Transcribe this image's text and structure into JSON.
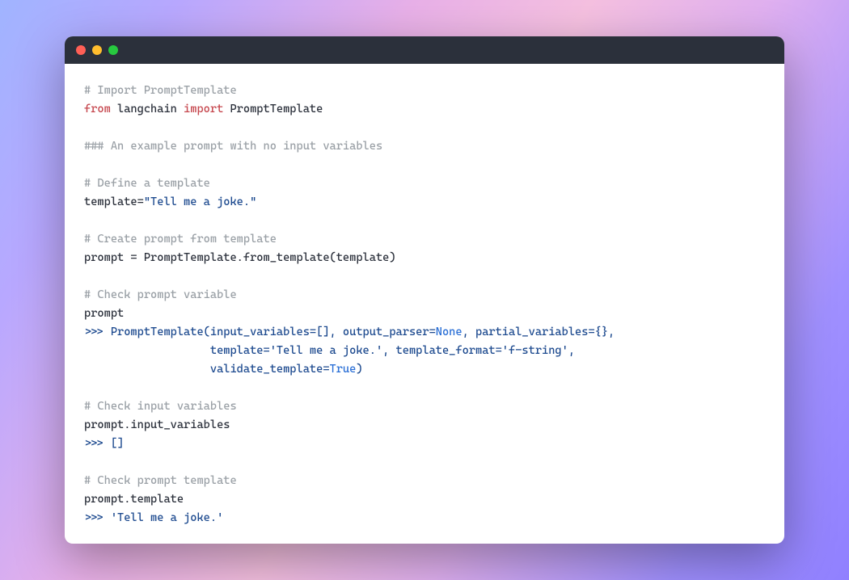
{
  "window": {
    "traffic_lights": [
      "close",
      "minimize",
      "zoom"
    ]
  },
  "code": {
    "c_import_prompttemplate": "# Import PromptTemplate",
    "kw_from": "from",
    "mod_langchain": " langchain ",
    "kw_import": "import",
    "cls_prompttemplate": " PromptTemplate",
    "c_example_header": "### An example prompt with no input variables",
    "c_define_template": "# Define a template",
    "assign_template_lhs": "template=",
    "str_tell_joke": "\"Tell me a joke.\"",
    "c_create_prompt": "# Create prompt from template",
    "line_create_prompt": "prompt = PromptTemplate.from_template(template)",
    "c_check_prompt_var": "# Check prompt variable",
    "line_prompt": "prompt",
    "repl1_a": ">>> PromptTemplate(input_variables=[], output_parser=",
    "lit_none": "None",
    "repl1_b": ", partial_variables={},",
    "repl2_a": "                   template=",
    "str_tell_joke_single": "'Tell me a joke.'",
    "repl2_b": ", template_format=",
    "str_fstring": "'f-string'",
    "repl2_c": ",",
    "repl3_a": "                   validate_template=",
    "lit_true": "True",
    "repl3_b": ")",
    "c_check_input_vars": "# Check input variables",
    "line_input_vars": "prompt.input_variables",
    "repl_empty_list": ">>> []",
    "c_check_template": "# Check prompt template",
    "line_prompt_template": "prompt.template",
    "repl_tell_joke_prefix": ">>> ",
    "repl_tell_joke_str": "'Tell me a joke.'"
  }
}
